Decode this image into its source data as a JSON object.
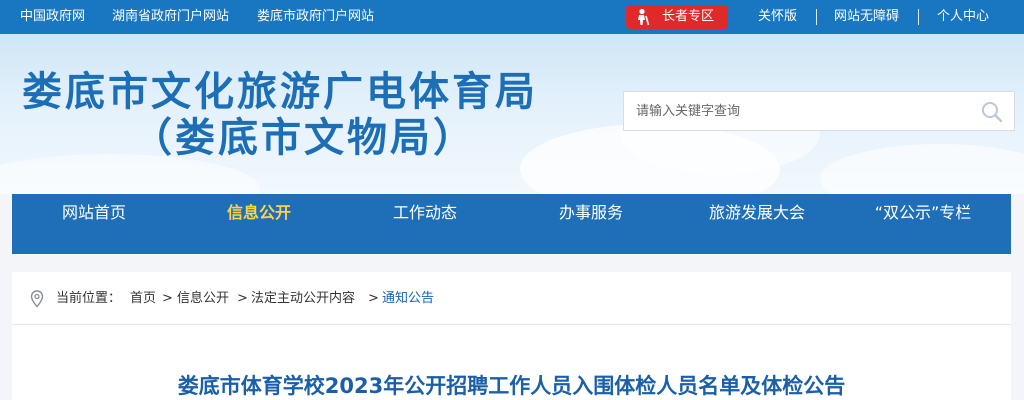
{
  "topbar": {
    "links": [
      "中国政府网",
      "湖南省政府门户网站",
      "娄底市政府门户网站"
    ],
    "elder_label": "长者专区",
    "right_links": [
      "关怀版",
      "网站无障碍",
      "个人中心"
    ]
  },
  "header": {
    "title_line1": "娄底市文化旅游广电体育局",
    "title_line2": "（娄底市文物局）",
    "search_placeholder": "请输入关键字查询"
  },
  "nav": {
    "items": [
      "网站首页",
      "信息公开",
      "工作动态",
      "办事服务",
      "旅游发展大会",
      "“双公示”专栏"
    ],
    "active": "信息公开"
  },
  "breadcrumb": {
    "prefix": "当前位置：",
    "items": [
      "首页",
      "信息公开",
      "法定主动公开内容",
      "通知公告"
    ],
    "separator": ">"
  },
  "article": {
    "title": "娄底市体育学校2023年公开招聘工作人员入围体检人员名单及体检公告"
  },
  "colors": {
    "topbar": "#1976c0",
    "nav": "#1e6fb8",
    "nav_active": "#ffd24a",
    "elder_button": "#e02a2a",
    "title": "#1c6fb6"
  }
}
